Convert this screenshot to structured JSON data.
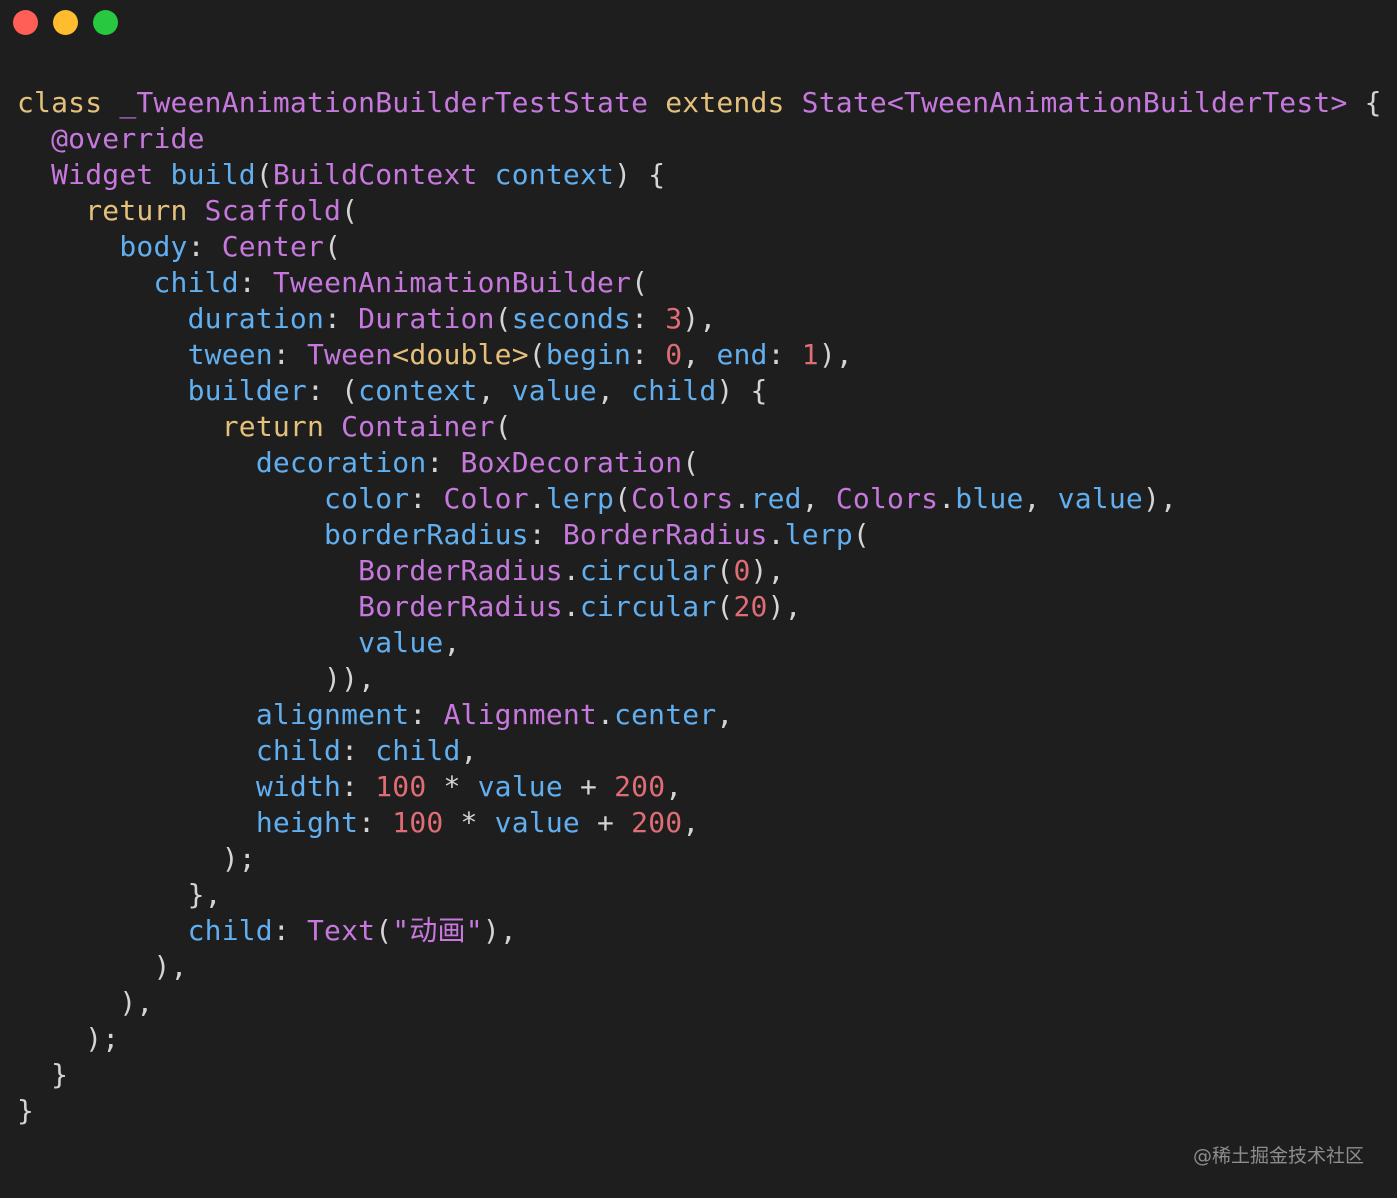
{
  "window": {
    "controls": [
      {
        "name": "close-button",
        "color": "#ff5f57"
      },
      {
        "name": "minimize-button",
        "color": "#febc2e"
      },
      {
        "name": "maximize-button",
        "color": "#28c840"
      }
    ]
  },
  "colors": {
    "keyword": "#e5c07b",
    "type": "#c678dd",
    "property": "#61afef",
    "number": "#e06c75",
    "string": "#c678dd",
    "punct": "#d4d4d4"
  },
  "code": {
    "lines": [
      [
        [
          "keyword",
          "class"
        ],
        [
          "punct",
          " "
        ],
        [
          "type",
          "_TweenAnimationBuilderTestState"
        ],
        [
          "punct",
          " "
        ],
        [
          "keyword",
          "extends"
        ],
        [
          "punct",
          " "
        ],
        [
          "type",
          "State<TweenAnimationBuilderTest>"
        ],
        [
          "punct",
          " {"
        ]
      ],
      [
        [
          "punct",
          "  "
        ],
        [
          "type",
          "@override"
        ]
      ],
      [
        [
          "punct",
          "  "
        ],
        [
          "type",
          "Widget"
        ],
        [
          "punct",
          " "
        ],
        [
          "property",
          "build"
        ],
        [
          "punct",
          "("
        ],
        [
          "type",
          "BuildContext"
        ],
        [
          "punct",
          " "
        ],
        [
          "property",
          "context"
        ],
        [
          "punct",
          ") {"
        ]
      ],
      [
        [
          "punct",
          "    "
        ],
        [
          "keyword",
          "return"
        ],
        [
          "punct",
          " "
        ],
        [
          "type",
          "Scaffold"
        ],
        [
          "punct",
          "("
        ]
      ],
      [
        [
          "punct",
          "      "
        ],
        [
          "property",
          "body"
        ],
        [
          "punct",
          ": "
        ],
        [
          "type",
          "Center"
        ],
        [
          "punct",
          "("
        ]
      ],
      [
        [
          "punct",
          "        "
        ],
        [
          "property",
          "child"
        ],
        [
          "punct",
          ": "
        ],
        [
          "type",
          "TweenAnimationBuilder"
        ],
        [
          "punct",
          "("
        ]
      ],
      [
        [
          "punct",
          "          "
        ],
        [
          "property",
          "duration"
        ],
        [
          "punct",
          ": "
        ],
        [
          "type",
          "Duration"
        ],
        [
          "punct",
          "("
        ],
        [
          "property",
          "seconds"
        ],
        [
          "punct",
          ": "
        ],
        [
          "number",
          "3"
        ],
        [
          "punct",
          "),"
        ]
      ],
      [
        [
          "punct",
          "          "
        ],
        [
          "property",
          "tween"
        ],
        [
          "punct",
          ": "
        ],
        [
          "type",
          "Tween"
        ],
        [
          "keyword",
          "<double>"
        ],
        [
          "punct",
          "("
        ],
        [
          "property",
          "begin"
        ],
        [
          "punct",
          ": "
        ],
        [
          "number",
          "0"
        ],
        [
          "punct",
          ", "
        ],
        [
          "property",
          "end"
        ],
        [
          "punct",
          ": "
        ],
        [
          "number",
          "1"
        ],
        [
          "punct",
          "),"
        ]
      ],
      [
        [
          "punct",
          "          "
        ],
        [
          "property",
          "builder"
        ],
        [
          "punct",
          ": ("
        ],
        [
          "property",
          "context"
        ],
        [
          "punct",
          ", "
        ],
        [
          "property",
          "value"
        ],
        [
          "punct",
          ", "
        ],
        [
          "property",
          "child"
        ],
        [
          "punct",
          ") {"
        ]
      ],
      [
        [
          "punct",
          "            "
        ],
        [
          "keyword",
          "return"
        ],
        [
          "punct",
          " "
        ],
        [
          "type",
          "Container"
        ],
        [
          "punct",
          "("
        ]
      ],
      [
        [
          "punct",
          "              "
        ],
        [
          "property",
          "decoration"
        ],
        [
          "punct",
          ": "
        ],
        [
          "type",
          "BoxDecoration"
        ],
        [
          "punct",
          "("
        ]
      ],
      [
        [
          "punct",
          "                  "
        ],
        [
          "property",
          "color"
        ],
        [
          "punct",
          ": "
        ],
        [
          "type",
          "Color"
        ],
        [
          "punct",
          "."
        ],
        [
          "property",
          "lerp"
        ],
        [
          "punct",
          "("
        ],
        [
          "type",
          "Colors"
        ],
        [
          "punct",
          "."
        ],
        [
          "property",
          "red"
        ],
        [
          "punct",
          ", "
        ],
        [
          "type",
          "Colors"
        ],
        [
          "punct",
          "."
        ],
        [
          "property",
          "blue"
        ],
        [
          "punct",
          ", "
        ],
        [
          "property",
          "value"
        ],
        [
          "punct",
          "),"
        ]
      ],
      [
        [
          "punct",
          "                  "
        ],
        [
          "property",
          "borderRadius"
        ],
        [
          "punct",
          ": "
        ],
        [
          "type",
          "BorderRadius"
        ],
        [
          "punct",
          "."
        ],
        [
          "property",
          "lerp"
        ],
        [
          "punct",
          "("
        ]
      ],
      [
        [
          "punct",
          "                    "
        ],
        [
          "type",
          "BorderRadius"
        ],
        [
          "punct",
          "."
        ],
        [
          "property",
          "circular"
        ],
        [
          "punct",
          "("
        ],
        [
          "number",
          "0"
        ],
        [
          "punct",
          "),"
        ]
      ],
      [
        [
          "punct",
          "                    "
        ],
        [
          "type",
          "BorderRadius"
        ],
        [
          "punct",
          "."
        ],
        [
          "property",
          "circular"
        ],
        [
          "punct",
          "("
        ],
        [
          "number",
          "20"
        ],
        [
          "punct",
          "),"
        ]
      ],
      [
        [
          "punct",
          "                    "
        ],
        [
          "property",
          "value"
        ],
        [
          "punct",
          ","
        ]
      ],
      [
        [
          "punct",
          "                  )),"
        ]
      ],
      [
        [
          "punct",
          "              "
        ],
        [
          "property",
          "alignment"
        ],
        [
          "punct",
          ": "
        ],
        [
          "type",
          "Alignment"
        ],
        [
          "punct",
          "."
        ],
        [
          "property",
          "center"
        ],
        [
          "punct",
          ","
        ]
      ],
      [
        [
          "punct",
          "              "
        ],
        [
          "property",
          "child"
        ],
        [
          "punct",
          ": "
        ],
        [
          "property",
          "child"
        ],
        [
          "punct",
          ","
        ]
      ],
      [
        [
          "punct",
          "              "
        ],
        [
          "property",
          "width"
        ],
        [
          "punct",
          ": "
        ],
        [
          "number",
          "100"
        ],
        [
          "punct",
          " * "
        ],
        [
          "property",
          "value"
        ],
        [
          "punct",
          " + "
        ],
        [
          "number",
          "200"
        ],
        [
          "punct",
          ","
        ]
      ],
      [
        [
          "punct",
          "              "
        ],
        [
          "property",
          "height"
        ],
        [
          "punct",
          ": "
        ],
        [
          "number",
          "100"
        ],
        [
          "punct",
          " * "
        ],
        [
          "property",
          "value"
        ],
        [
          "punct",
          " + "
        ],
        [
          "number",
          "200"
        ],
        [
          "punct",
          ","
        ]
      ],
      [
        [
          "punct",
          "            );"
        ]
      ],
      [
        [
          "punct",
          "          },"
        ]
      ],
      [
        [
          "punct",
          "          "
        ],
        [
          "property",
          "child"
        ],
        [
          "punct",
          ": "
        ],
        [
          "type",
          "Text"
        ],
        [
          "punct",
          "("
        ],
        [
          "string",
          "\"动画\""
        ],
        [
          "punct",
          "),"
        ]
      ],
      [
        [
          "punct",
          "        ),"
        ]
      ],
      [
        [
          "punct",
          "      ),"
        ]
      ],
      [
        [
          "punct",
          "    );"
        ]
      ],
      [
        [
          "punct",
          "  }"
        ]
      ],
      [
        [
          "punct",
          "}"
        ]
      ]
    ]
  },
  "watermark": {
    "text": "@稀土掘金技术社区"
  }
}
